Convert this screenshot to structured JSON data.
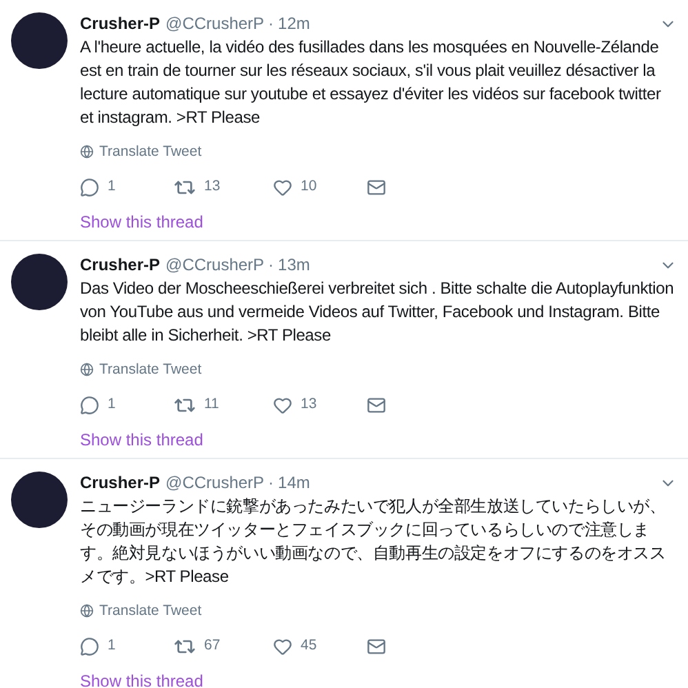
{
  "tweets": [
    {
      "name": "Crusher-P",
      "handle": "@CCrusherP",
      "separator": "·",
      "time": "12m",
      "text": "A l'heure actuelle, la vidéo des fusillades dans les mosquées en Nouvelle-Zélande est en train de tourner sur les réseaux sociaux, s'il vous plait veuillez désactiver la lecture automatique sur youtube et essayez d'éviter les vidéos sur facebook twitter et instagram. >RT Please",
      "translate": "Translate Tweet",
      "replies": "1",
      "retweets": "13",
      "likes": "10",
      "thread_link": "Show this thread"
    },
    {
      "name": "Crusher-P",
      "handle": "@CCrusherP",
      "separator": "·",
      "time": "13m",
      "text": "Das Video der Moscheeschießerei verbreitet sich . Bitte schalte die Autoplayfunktion von YouTube aus und vermeide Videos auf Twitter, Facebook und Instagram. Bitte bleibt alle in Sicherheit. >RT Please",
      "translate": "Translate Tweet",
      "replies": "1",
      "retweets": "11",
      "likes": "13",
      "thread_link": "Show this thread"
    },
    {
      "name": "Crusher-P",
      "handle": "@CCrusherP",
      "separator": "·",
      "time": "14m",
      "text": "ニュージーランドに銃撃があったみたいで犯人が全部生放送していたらしいが、その動画が現在ツイッターとフェイスブックに回っているらしいので注意します。絶対見ないほうがいい動画なので、自動再生の設定をオフにするのをオススメです。>RT Please",
      "translate": "Translate Tweet",
      "replies": "1",
      "retweets": "67",
      "likes": "45",
      "thread_link": "Show this thread"
    }
  ]
}
